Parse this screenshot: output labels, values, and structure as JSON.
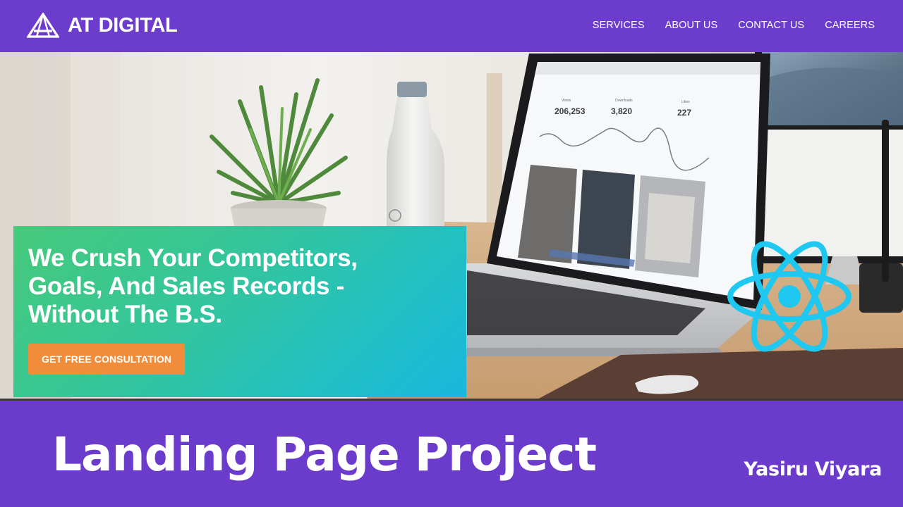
{
  "brand": {
    "name": "AT DIGITAL",
    "logo_icon": "triangle-logo-icon"
  },
  "nav": {
    "items": [
      {
        "label": "SERVICES"
      },
      {
        "label": "ABOUT US"
      },
      {
        "label": "CONTACT US"
      },
      {
        "label": "CAREERS"
      }
    ]
  },
  "hero": {
    "headline_lines": [
      "We Crush Your Competitors,",
      "Goals, And Sales Records -",
      "Without The B.S."
    ],
    "cta_label": "GET FREE CONSULTATION",
    "screen_stats": [
      {
        "label": "Views",
        "value": "206,253"
      },
      {
        "label": "Downloads",
        "value": "3,820"
      },
      {
        "label": "Likes",
        "value": "227"
      }
    ]
  },
  "footer": {
    "project_title": "Landing Page Project",
    "author": "Yasiru Viyara"
  },
  "colors": {
    "brand_purple": "#6c3dcc",
    "cta_orange": "#f08c3a",
    "card_green": "#46c97a",
    "card_blue": "#1ab7de",
    "react_cyan": "#1ec8f0"
  },
  "icons": {
    "react_logo": "react-logo-icon"
  }
}
